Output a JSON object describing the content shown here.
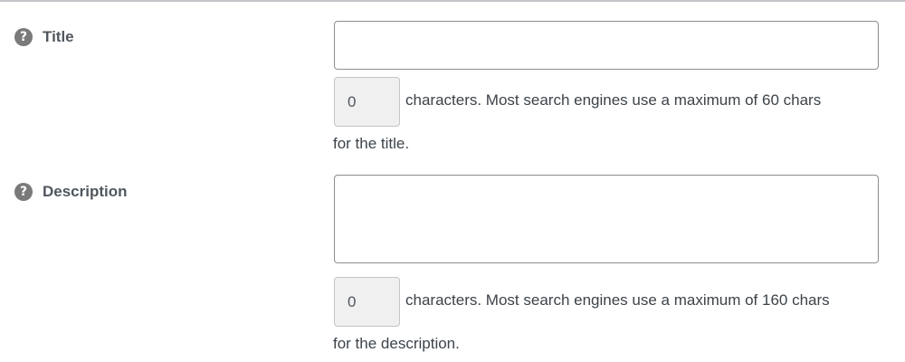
{
  "title_field": {
    "label": "Title",
    "help_icon": "question-mark-icon",
    "input_value": "",
    "counter": "0",
    "hint_line1": "characters. Most search engines use a maximum of 60 chars",
    "hint_line2": "for the title."
  },
  "description_field": {
    "label": "Description",
    "help_icon": "question-mark-icon",
    "input_value": "",
    "counter": "0",
    "hint_line1": "characters. Most search engines use a maximum of 160 chars",
    "hint_line2": "for the description."
  },
  "colors": {
    "help_icon_bg": "#7a7a7a",
    "counter_bg": "#f0f0f1",
    "input_border": "#8c8f94"
  }
}
